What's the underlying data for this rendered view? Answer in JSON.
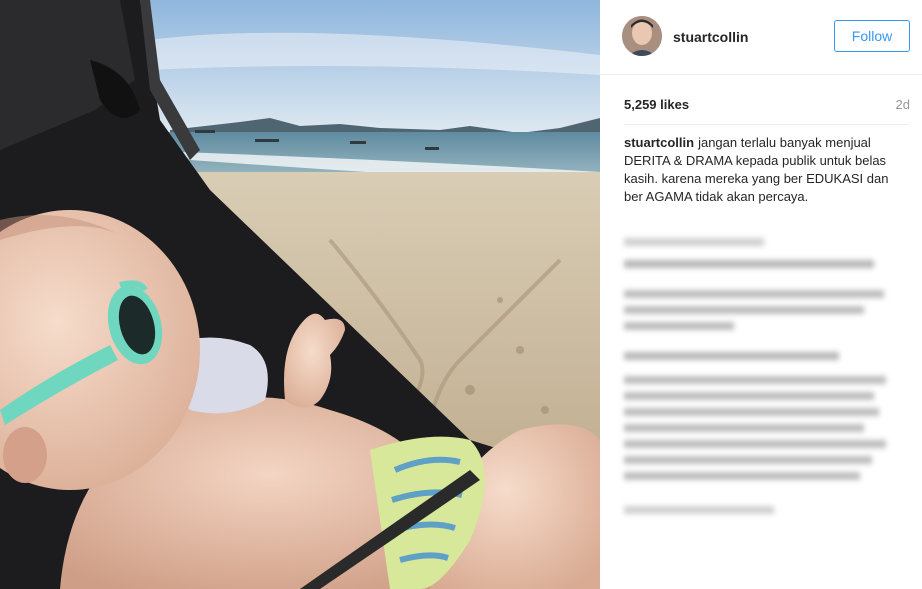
{
  "post": {
    "username": "stuartcollin",
    "follow_label": "Follow",
    "likes": "5,259 likes",
    "age": "2d",
    "caption_user": "stuartcollin",
    "caption_text": "jangan terlalu banyak menjual DERITA & DRAMA kepada publik untuk belas kasih. karena mereka yang ber EDUKASI dan ber AGAMA tidak akan percaya."
  },
  "colors": {
    "follow_blue": "#3897f0",
    "text_dark": "#262626",
    "text_muted": "#999999"
  },
  "image": {
    "description_icon": "photo-baby-beach"
  }
}
